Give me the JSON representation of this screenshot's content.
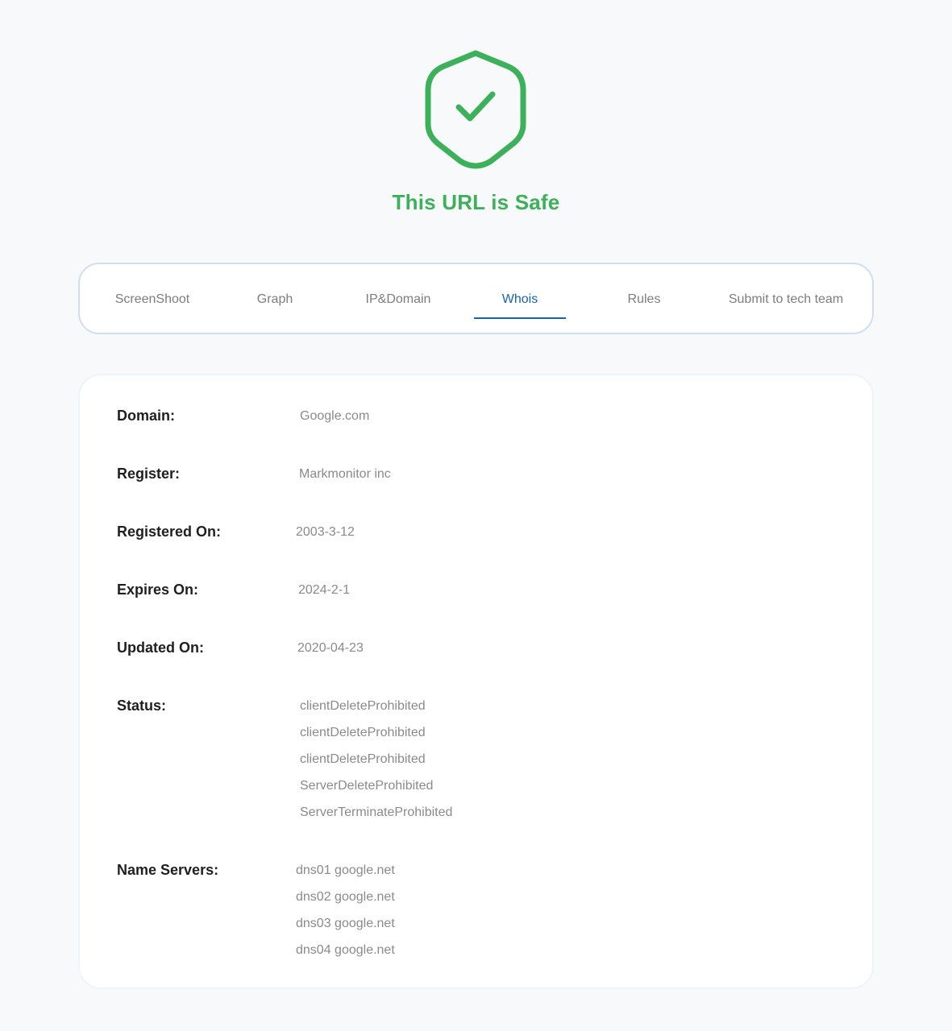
{
  "status": {
    "title": "This URL is Safe",
    "icon": "shield-check-icon",
    "color": "#3db05a"
  },
  "tabs": [
    {
      "label": "ScreenShoot",
      "active": false
    },
    {
      "label": "Graph",
      "active": false
    },
    {
      "label": "IP&Domain",
      "active": false
    },
    {
      "label": "Whois",
      "active": true
    },
    {
      "label": "Rules",
      "active": false
    },
    {
      "label": "Submit to tech team",
      "active": false
    }
  ],
  "accent_color": "#1b63a8",
  "whois": {
    "domain": {
      "label": "Domain:",
      "value": "Google.com"
    },
    "register": {
      "label": "Register:",
      "value": "Markmonitor inc"
    },
    "registered_on": {
      "label": "Registered On:",
      "value": "2003-3-12"
    },
    "expires_on": {
      "label": "Expires On:",
      "value": "2024-2-1"
    },
    "updated_on": {
      "label": "Updated On:",
      "value": "2020-04-23"
    },
    "status": {
      "label": "Status:",
      "values": [
        "clientDeleteProhibited",
        "clientDeleteProhibited",
        "clientDeleteProhibited",
        "ServerDeleteProhibited",
        "ServerTerminateProhibited"
      ]
    },
    "name_servers": {
      "label": "Name Servers:",
      "values": [
        "dns01 google.net",
        "dns02 google.net",
        "dns03 google.net",
        "dns04 google.net"
      ]
    }
  }
}
